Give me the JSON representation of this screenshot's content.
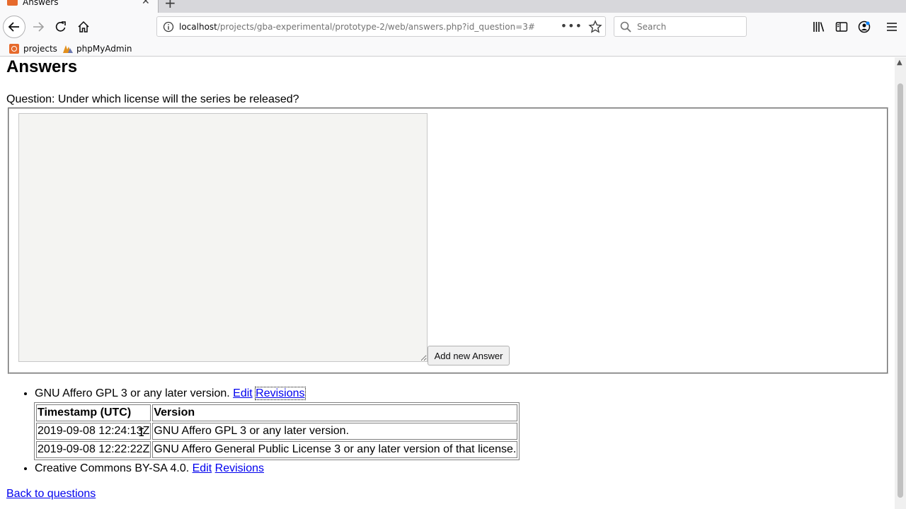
{
  "browser": {
    "tab_title": "Answers",
    "url_host": "localhost",
    "url_path": "/projects/gba-experimental/prototype-2/web/answers.php?id_question=3#",
    "search_placeholder": "Search",
    "bookmarks": [
      "projects",
      "phpMyAdmin"
    ],
    "icons": {
      "tab_favicon": "xampp-icon",
      "back": "back-arrow-icon",
      "forward": "forward-arrow-icon",
      "reload": "reload-icon",
      "home": "home-icon",
      "info": "info-icon",
      "page_actions": "more-dots-icon",
      "bookmark_star": "star-icon",
      "search": "search-icon",
      "library": "library-icon",
      "sidebar": "sidebar-icon",
      "account": "account-icon",
      "menu": "hamburger-menu-icon"
    }
  },
  "page": {
    "title": "Answers",
    "question": "Question: Under which license will the series be released?",
    "add_button": "Add new Answer",
    "answers": [
      {
        "text": "GNU Affero GPL 3 or any later version.",
        "edit_label": "Edit",
        "revisions_label": "Revisions",
        "revisions_table": {
          "headers": [
            "Timestamp (UTC)",
            "Version"
          ],
          "rows": [
            [
              "2019-09-08 12:24:13Z",
              "GNU Affero GPL 3 or any later version."
            ],
            [
              "2019-09-08 12:22:22Z",
              "GNU Affero General Public License 3 or any later version of that license."
            ]
          ]
        }
      },
      {
        "text": "Creative Commons BY-SA 4.0.",
        "edit_label": "Edit",
        "revisions_label": "Revisions"
      }
    ],
    "back_link": "Back to questions"
  },
  "colors": {
    "link": "#0000ee",
    "chrome_bg": "#f9f9fa",
    "tabstrip_bg": "#d7d7db",
    "textarea_bg": "#f4f4f2",
    "xampp_orange": "#e66a2c"
  }
}
